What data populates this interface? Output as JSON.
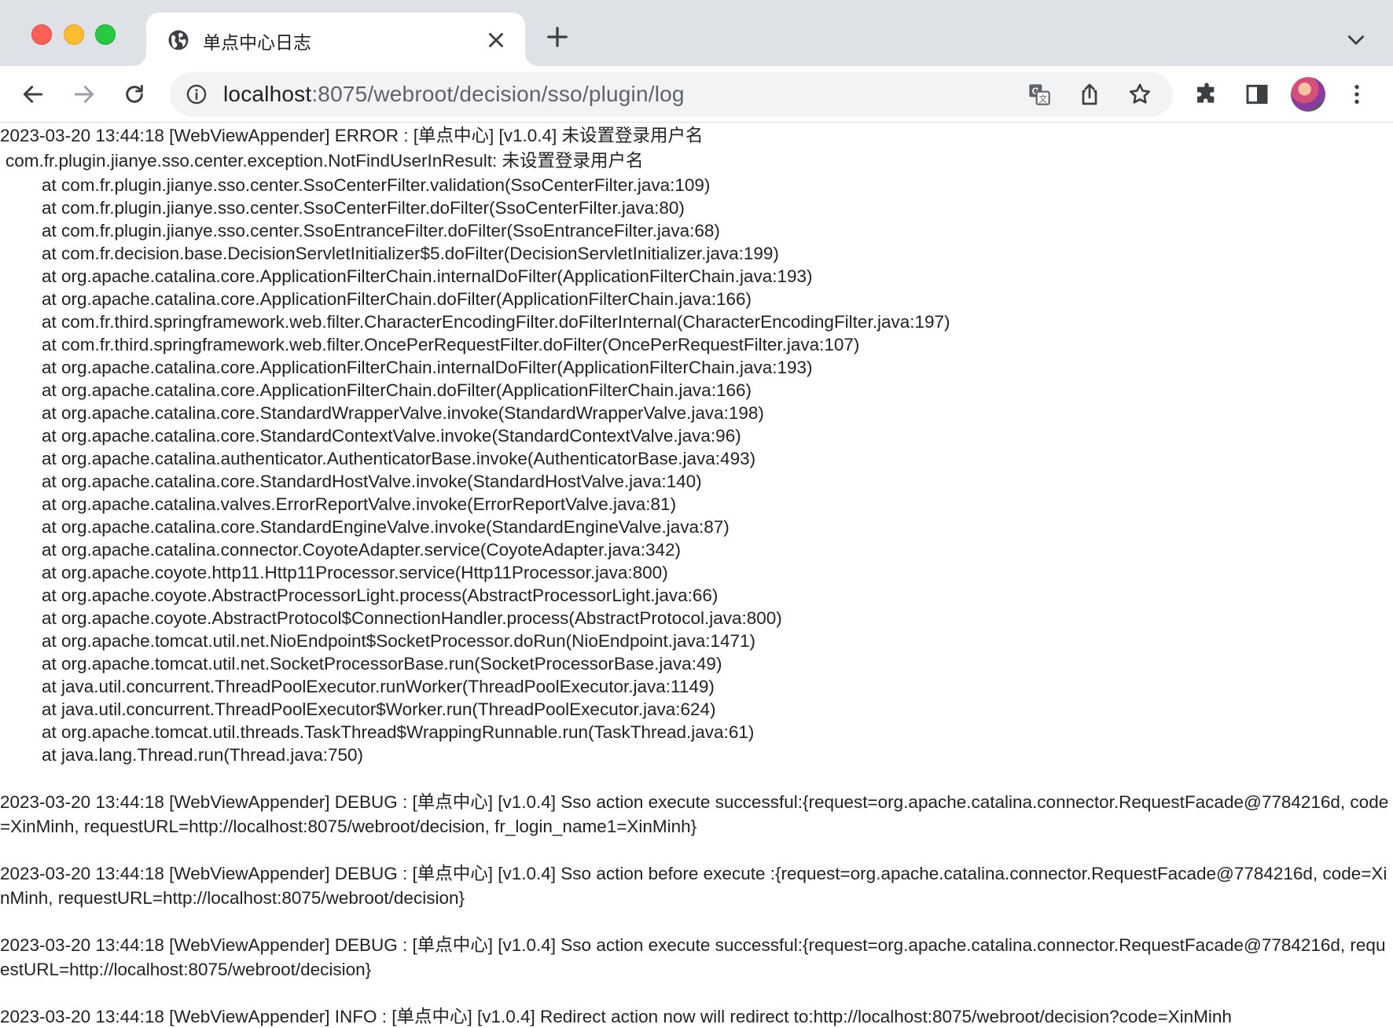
{
  "browser": {
    "tab": {
      "title": "单点中心日志",
      "icon": "globe-icon"
    },
    "address_bar": {
      "host": "localhost",
      "path": ":8075/webroot/decision/sso/plugin/log"
    },
    "colors": {
      "tabstrip_bg": "#dee1e6",
      "omnibox_bg": "#f1f3f4",
      "close_red": "#ff5f57",
      "minimize_yellow": "#febc2e",
      "zoom_green": "#28c840"
    }
  },
  "log": {
    "error_header": "2023-03-20 13:44:18 [WebViewAppender] ERROR : [单点中心] [v1.0.4] 未设置登录用户名",
    "exception": "com.fr.plugin.jianye.sso.center.exception.NotFindUserInResult: 未设置登录用户名",
    "stack_frames": [
      "at com.fr.plugin.jianye.sso.center.SsoCenterFilter.validation(SsoCenterFilter.java:109)",
      "at com.fr.plugin.jianye.sso.center.SsoCenterFilter.doFilter(SsoCenterFilter.java:80)",
      "at com.fr.plugin.jianye.sso.center.SsoEntranceFilter.doFilter(SsoEntranceFilter.java:68)",
      "at com.fr.decision.base.DecisionServletInitializer$5.doFilter(DecisionServletInitializer.java:199)",
      "at org.apache.catalina.core.ApplicationFilterChain.internalDoFilter(ApplicationFilterChain.java:193)",
      "at org.apache.catalina.core.ApplicationFilterChain.doFilter(ApplicationFilterChain.java:166)",
      "at com.fr.third.springframework.web.filter.CharacterEncodingFilter.doFilterInternal(CharacterEncodingFilter.java:197)",
      "at com.fr.third.springframework.web.filter.OncePerRequestFilter.doFilter(OncePerRequestFilter.java:107)",
      "at org.apache.catalina.core.ApplicationFilterChain.internalDoFilter(ApplicationFilterChain.java:193)",
      "at org.apache.catalina.core.ApplicationFilterChain.doFilter(ApplicationFilterChain.java:166)",
      "at org.apache.catalina.core.StandardWrapperValve.invoke(StandardWrapperValve.java:198)",
      "at org.apache.catalina.core.StandardContextValve.invoke(StandardContextValve.java:96)",
      "at org.apache.catalina.authenticator.AuthenticatorBase.invoke(AuthenticatorBase.java:493)",
      "at org.apache.catalina.core.StandardHostValve.invoke(StandardHostValve.java:140)",
      "at org.apache.catalina.valves.ErrorReportValve.invoke(ErrorReportValve.java:81)",
      "at org.apache.catalina.core.StandardEngineValve.invoke(StandardEngineValve.java:87)",
      "at org.apache.catalina.connector.CoyoteAdapter.service(CoyoteAdapter.java:342)",
      "at org.apache.coyote.http11.Http11Processor.service(Http11Processor.java:800)",
      "at org.apache.coyote.AbstractProcessorLight.process(AbstractProcessorLight.java:66)",
      "at org.apache.coyote.AbstractProtocol$ConnectionHandler.process(AbstractProtocol.java:800)",
      "at org.apache.tomcat.util.net.NioEndpoint$SocketProcessor.doRun(NioEndpoint.java:1471)",
      "at org.apache.tomcat.util.net.SocketProcessorBase.run(SocketProcessorBase.java:49)",
      "at java.util.concurrent.ThreadPoolExecutor.runWorker(ThreadPoolExecutor.java:1149)",
      "at java.util.concurrent.ThreadPoolExecutor$Worker.run(ThreadPoolExecutor.java:624)",
      "at org.apache.tomcat.util.threads.TaskThread$WrappingRunnable.run(TaskThread.java:61)",
      "at java.lang.Thread.run(Thread.java:750)"
    ],
    "entries": [
      "2023-03-20 13:44:18 [WebViewAppender] DEBUG : [单点中心] [v1.0.4] Sso action execute successful:{request=org.apache.catalina.connector.RequestFacade@7784216d, code=XinMinh, requestURL=http://localhost:8075/webroot/decision, fr_login_name1=XinMinh}",
      "2023-03-20 13:44:18 [WebViewAppender] DEBUG : [单点中心] [v1.0.4] Sso action before execute :{request=org.apache.catalina.connector.RequestFacade@7784216d, code=XinMinh, requestURL=http://localhost:8075/webroot/decision}",
      "2023-03-20 13:44:18 [WebViewAppender] DEBUG : [单点中心] [v1.0.4] Sso action execute successful:{request=org.apache.catalina.connector.RequestFacade@7784216d, requestURL=http://localhost:8075/webroot/decision}",
      "2023-03-20 13:44:18 [WebViewAppender] INFO : [单点中心] [v1.0.4] Redirect action now will redirect to:http://localhost:8075/webroot/decision?code=XinMinh"
    ]
  }
}
